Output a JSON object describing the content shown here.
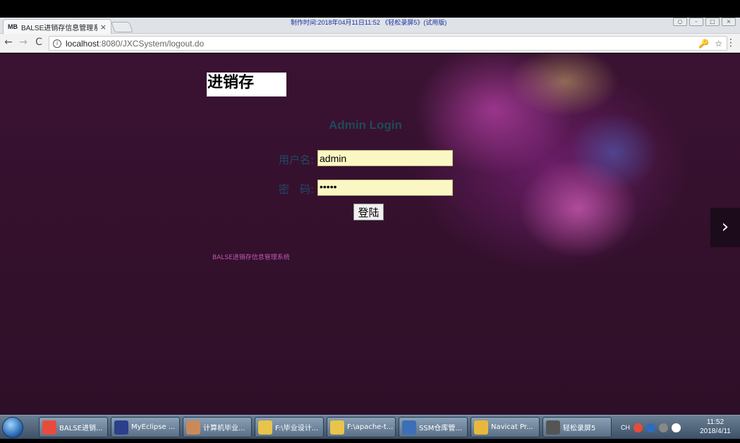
{
  "browser": {
    "tab_title": "BALSE进销存信息管理系",
    "tab_favicon": "MB",
    "tab_close": "×",
    "watermark": "制作时间:2018年04月11日11:52 《轻松录屏5》(试用版)",
    "url_host": "localhost",
    "url_path": ":8080/JXCSystem/logout.do",
    "back": "←",
    "forward": "→",
    "reload": "C",
    "info": "i",
    "key": "🔑",
    "star": "☆",
    "menu": "⋮"
  },
  "page": {
    "logo": "进销存",
    "login_title": "Admin Login",
    "username_label": "用户名:",
    "username_value": "admin",
    "password_label": "密　码:",
    "password_value": "•••••",
    "login_button": "登陆",
    "footer": "BALSE进销存信息管理系统",
    "next_arrow": "›"
  },
  "taskbar": {
    "items": [
      {
        "label": "BALSE进销...",
        "icon": "chrome-icon",
        "color": "#e84b3c"
      },
      {
        "label": "MyEclipse ...",
        "icon": "myeclipse-icon",
        "color": "#2b3f8c"
      },
      {
        "label": "计算机毕业...",
        "icon": "users-icon",
        "color": "#c98a5a"
      },
      {
        "label": "F:\\毕业设计...",
        "icon": "folder-icon",
        "color": "#e8c54a"
      },
      {
        "label": "F:\\apache-t...",
        "icon": "folder-icon",
        "color": "#e8c54a"
      },
      {
        "label": "SSM仓库管...",
        "icon": "document-icon",
        "color": "#3d6fb8"
      },
      {
        "label": "Navicat Pr...",
        "icon": "navicat-icon",
        "color": "#e8b83a"
      },
      {
        "label": "轻松录屏5",
        "icon": "recorder-icon",
        "color": "#555555"
      }
    ],
    "tray_lang": "CH",
    "clock_time": "11:52",
    "clock_date": "2018/4/11"
  }
}
